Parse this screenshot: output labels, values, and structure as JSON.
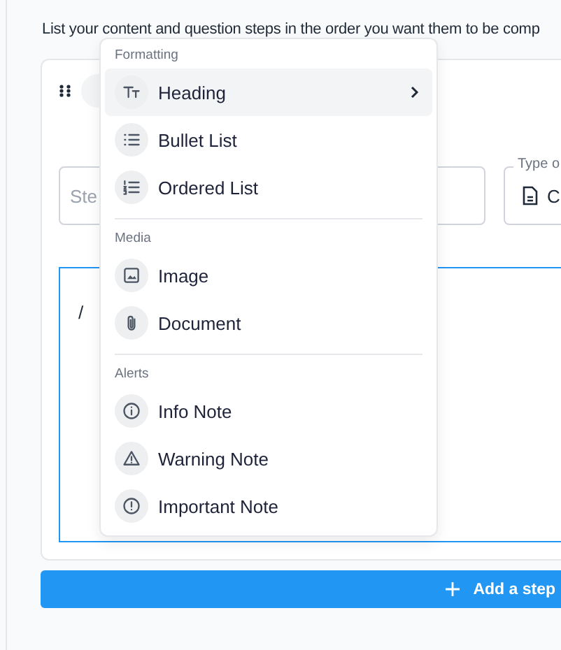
{
  "instructions": "List your content and question steps in the order you want them to be comp",
  "step": {
    "title_field": {
      "placeholder": "Ste"
    },
    "type_field": {
      "label": "Type o",
      "value": "C"
    },
    "editor": {
      "value": "/"
    }
  },
  "menu": {
    "sections": [
      {
        "title": "Formatting",
        "items": [
          {
            "label": "Heading",
            "kind": "heading",
            "selected": true,
            "has_submenu": true
          },
          {
            "label": "Bullet List",
            "kind": "bullets",
            "selected": false,
            "has_submenu": false
          },
          {
            "label": "Ordered List",
            "kind": "numbers",
            "selected": false,
            "has_submenu": false
          }
        ]
      },
      {
        "title": "Media",
        "items": [
          {
            "label": "Image",
            "kind": "image",
            "selected": false,
            "has_submenu": false
          },
          {
            "label": "Document",
            "kind": "clip",
            "selected": false,
            "has_submenu": false
          }
        ]
      },
      {
        "title": "Alerts",
        "items": [
          {
            "label": "Info Note",
            "kind": "info",
            "selected": false,
            "has_submenu": false
          },
          {
            "label": "Warning Note",
            "kind": "warning",
            "selected": false,
            "has_submenu": false
          },
          {
            "label": "Important Note",
            "kind": "important",
            "selected": false,
            "has_submenu": false
          }
        ]
      }
    ]
  },
  "add_button": {
    "label": "Add a step"
  }
}
